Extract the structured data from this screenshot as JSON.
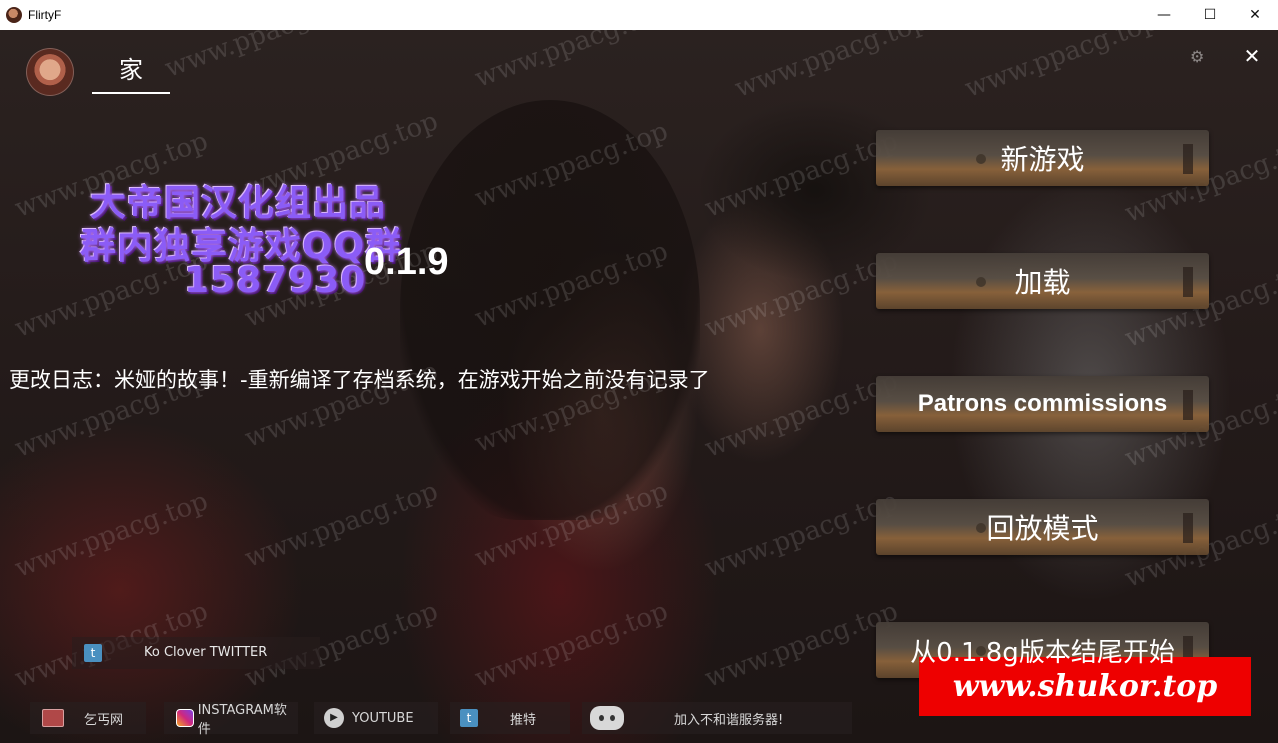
{
  "window": {
    "title": "FlirtyF",
    "minimize_glyph": "—",
    "maximize_glyph": "☐",
    "close_glyph": "✕"
  },
  "header": {
    "home_tab_label": "家",
    "settings_icon": "gear-icon",
    "close_glyph": "✕"
  },
  "logo": {
    "line1": "大帝国汉化组出品",
    "line2": "群内独享游戏QQ群",
    "line3": "1587930",
    "color": "#8b5cf6"
  },
  "version": "0.1.9",
  "changelog": "更改日志：米娅的故事！-重新编译了存档系统，在游戏开始之前没有记录了",
  "menu": {
    "new_game": "新游戏",
    "load": "加载",
    "patrons": "Patrons commissions",
    "replay": "回放模式",
    "start_from": "从0.1.8g版本结尾开始"
  },
  "social": {
    "twitter_ko": "Ko Clover TWITTER",
    "beggar": "乞丐网",
    "instagram": "INSTAGRAM软件",
    "youtube": "YOUTUBE",
    "tweet": "推特",
    "discord": "加入不和谐服务器!"
  },
  "watermark_text": "www.ppacg.top",
  "ad_banner": {
    "text": "www.shukor.top",
    "color": "#ee0000"
  }
}
